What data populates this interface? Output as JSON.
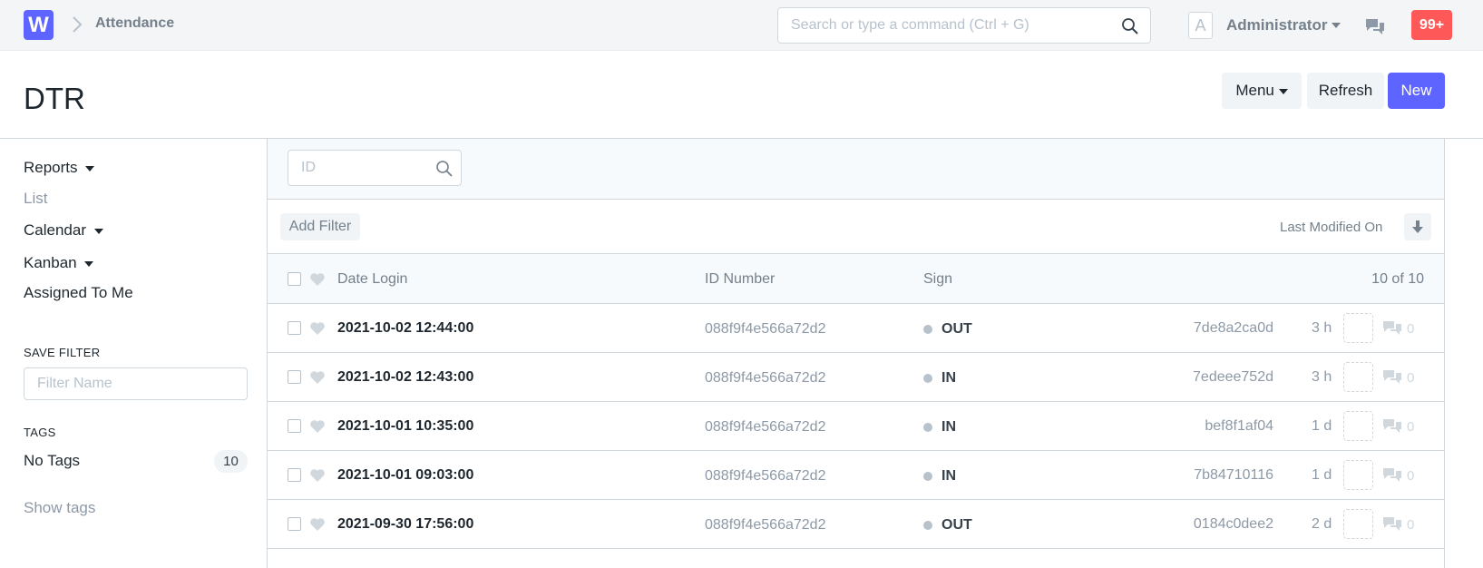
{
  "navbar": {
    "logo_letter": "W",
    "breadcrumb": "Attendance",
    "search_placeholder": "Search or type a command (Ctrl + G)",
    "avatar_letter": "A",
    "user_name": "Administrator",
    "notification_count": "99+"
  },
  "page": {
    "title": "DTR",
    "menu_label": "Menu",
    "refresh_label": "Refresh",
    "new_label": "New",
    "new_color": "#5e64ff"
  },
  "sidebar": {
    "items": [
      {
        "label": "Reports"
      },
      {
        "label": "List"
      },
      {
        "label": "Calendar"
      },
      {
        "label": "Kanban"
      },
      {
        "label": "Assigned To Me"
      }
    ],
    "save_filter_label": "SAVE FILTER",
    "filter_name_placeholder": "Filter Name",
    "tags_label": "TAGS",
    "no_tags_label": "No Tags",
    "no_tags_count": "10",
    "show_tags_label": "Show tags"
  },
  "list": {
    "id_placeholder": "ID",
    "add_filter_label": "Add Filter",
    "sort_label": "Last Modified On",
    "columns": {
      "date": "Date Login",
      "id_number": "ID Number",
      "sign": "Sign",
      "count": "10 of 10"
    },
    "rows": [
      {
        "date": "2021-10-02 12:44:00",
        "id_number": "088f9f4e566a72d2",
        "sign": "OUT",
        "name": "7de8a2ca0d",
        "time": "3 h",
        "comments": "0"
      },
      {
        "date": "2021-10-02 12:43:00",
        "id_number": "088f9f4e566a72d2",
        "sign": "IN",
        "name": "7edeee752d",
        "time": "3 h",
        "comments": "0"
      },
      {
        "date": "2021-10-01 10:35:00",
        "id_number": "088f9f4e566a72d2",
        "sign": "IN",
        "name": "bef8f1af04",
        "time": "1 d",
        "comments": "0"
      },
      {
        "date": "2021-10-01 09:03:00",
        "id_number": "088f9f4e566a72d2",
        "sign": "IN",
        "name": "7b84710116",
        "time": "1 d",
        "comments": "0"
      },
      {
        "date": "2021-09-30 17:56:00",
        "id_number": "088f9f4e566a72d2",
        "sign": "OUT",
        "name": "0184c0dee2",
        "time": "2 d",
        "comments": "0"
      }
    ]
  }
}
